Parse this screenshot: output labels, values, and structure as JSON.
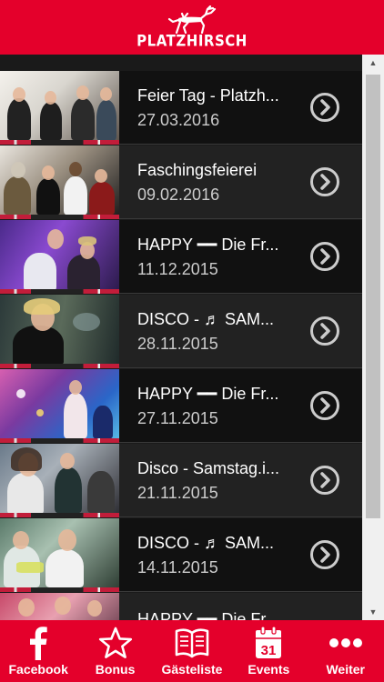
{
  "header": {
    "logo_text": "PLATZHIRSCH"
  },
  "events": [
    {
      "title": "Feier Tag - Platzh...",
      "date": "27.03.2016"
    },
    {
      "title": "Faschingsfeierei",
      "date": "09.02.2016"
    },
    {
      "title": "HAPPY ━━ Die Fr...",
      "date": "11.12.2015"
    },
    {
      "title": "DISCO - ♬ SAM...",
      "date": "28.11.2015"
    },
    {
      "title": "HAPPY ━━ Die Fr...",
      "date": "27.11.2015"
    },
    {
      "title": "Disco - Samstag.i...",
      "date": "21.11.2015"
    },
    {
      "title": "DISCO - ♬ SAM...",
      "date": "14.11.2015"
    },
    {
      "title": "HAPPY ━━ Die Fr...",
      "date": ""
    }
  ],
  "tabs": [
    {
      "label": "Facebook",
      "icon": "facebook-icon"
    },
    {
      "label": "Bonus",
      "icon": "star-icon"
    },
    {
      "label": "Gästeliste",
      "icon": "book-icon"
    },
    {
      "label": "Events",
      "icon": "calendar-icon",
      "icon_number": "31"
    },
    {
      "label": "Weiter",
      "icon": "more-icon"
    }
  ],
  "colors": {
    "brand_red": "#e4002b",
    "row_dark": "#111111",
    "row_light": "#222222"
  }
}
